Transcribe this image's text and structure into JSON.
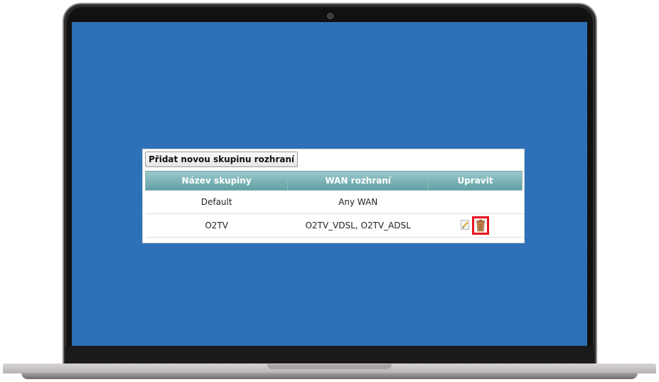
{
  "add_group_button": "Přidat novou skupinu rozhraní",
  "table": {
    "headers": [
      "Název skupiny",
      "WAN rozhraní",
      "Upravit"
    ],
    "rows": [
      {
        "name": "Default",
        "wan": "Any WAN",
        "actions": []
      },
      {
        "name": "O2TV",
        "wan": "O2TV_VDSL, O2TV_ADSL",
        "actions": [
          "pencil-icon",
          "trash-icon"
        ]
      }
    ]
  },
  "colors": {
    "screen_background": "#2a6fb8",
    "header_gradient_top": "#9bc9cc",
    "header_gradient_bottom": "#5f9ea3",
    "highlight": "#e8141e"
  }
}
